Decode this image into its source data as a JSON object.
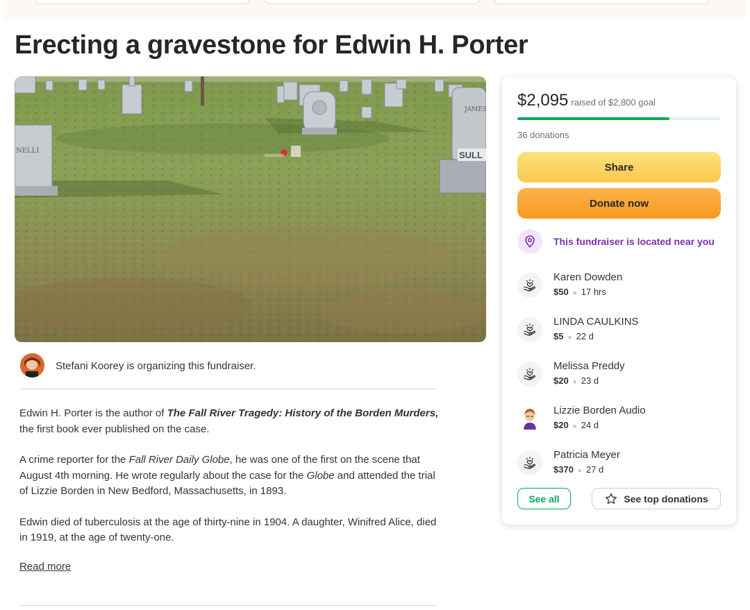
{
  "page": {
    "title": "Erecting a gravestone for Edwin H. Porter"
  },
  "hero": {
    "icon": "cemetery-photo",
    "stone_labels": [
      "JAMES",
      "SULL",
      "NELLI"
    ]
  },
  "organizer": {
    "text": "Stefani Koorey is organizing this fundraiser."
  },
  "story": {
    "p1_prefix": "Edwin H. Porter is the author of ",
    "p1_book": "The Fall River Tragedy: History of the Borden Murders,",
    "p1_suffix": " the first book ever published on the case.",
    "p2_prefix": "A crime reporter for the ",
    "p2_paper": "Fall River Daily Globe",
    "p2_mid": ", he was one of the first on the scene that August 4th morning. He wrote regularly about the case for the ",
    "p2_globe": "Globe",
    "p2_suffix": " and attended the trial of Lizzie Borden in New Bedford, Massachusetts, in 1893.",
    "p3": "Edwin died of tuberculosis at the age of thirty-nine in 1904. A daughter, Winifred Alice, died in 1919, at the age of twenty-one.",
    "read_more": "Read more"
  },
  "donation_card": {
    "raised_amount": "$2,095",
    "raised_goal": "raised of $2,800 goal",
    "progress_fraction": 0.748,
    "donations_count": "36 donations",
    "share_label": "Share",
    "donate_label": "Donate now",
    "near_text": "This fundraiser is located near you",
    "donors": [
      {
        "name": "Karen Dowden",
        "amount": "$50",
        "time": "17 hrs",
        "icon": "heart-hand-icon"
      },
      {
        "name": "LINDA CAULKINS",
        "amount": "$5",
        "time": "22 d",
        "icon": "heart-hand-icon"
      },
      {
        "name": "Melissa Preddy",
        "amount": "$20",
        "time": "23 d",
        "icon": "heart-hand-icon"
      },
      {
        "name": "Lizzie Borden Audio",
        "amount": "$20",
        "time": "24 d",
        "icon": "avatar"
      },
      {
        "name": "Patricia Meyer",
        "amount": "$370",
        "time": "27 d",
        "icon": "heart-hand-icon"
      }
    ],
    "see_all_label": "See all",
    "see_top_label": "See top donations"
  },
  "colors": {
    "accent_green": "#02a95c",
    "share_yellow": "#f9c74f",
    "donate_orange": "#f69a22",
    "near_purple": "#7b2fb0"
  }
}
